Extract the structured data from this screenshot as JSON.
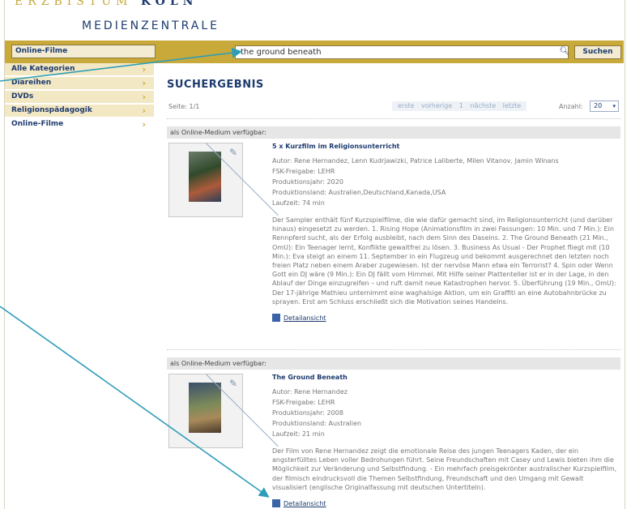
{
  "header": {
    "org_top": "ERZBISTUM",
    "org_top_bold": "KÖLN",
    "org_bottom": "MEDIENZENTRALE"
  },
  "toolbar": {
    "breadcrumb": "Online-Filme",
    "search_value": "the ground beneath",
    "search_button": "Suchen"
  },
  "sidebar": {
    "items": [
      {
        "label": "Alle Kategorien"
      },
      {
        "label": "Diareihen"
      },
      {
        "label": "DVDs"
      },
      {
        "label": "Religionspädagogik"
      },
      {
        "label": "Online-Filme"
      }
    ]
  },
  "main": {
    "heading": "SUCHERGEBNIS",
    "page_info": "Seite: 1/1",
    "pager": {
      "first": "erste",
      "prev": "vorherige",
      "page": "1",
      "next": "nächste",
      "last": "letzte"
    },
    "anzahl_label": "Anzahl:",
    "anzahl_value": "20"
  },
  "results": [
    {
      "availability": "als Online-Medium verfügbar:",
      "title": "5 x Kurzfilm im Religionsunterricht",
      "author": "Autor: Rene Hernandez, Lenn Kudrjawizki, Patrice Laliberte, Milen Vitanov, Jamin Winans",
      "fsk": "FSK-Freigabe: LEHR",
      "year": "Produktionsjahr: 2020",
      "country": "Produktionsland: Australien,Deutschland,Kanada,USA",
      "runtime": "Laufzeit: 74 min",
      "description": "Der Sampler enthält fünf Kurzspielfilme, die wie dafür gemacht sind, im Religionsunterricht (und darüber hinaus) eingesetzt zu werden. 1. Rising Hope (Animationsfilm in zwei Fassungen: 10 Min. und 7 Min.): Ein Rennpferd sucht, als der Erfolg ausbleibt, nach dem Sinn des Daseins. 2. The Ground Beneath (21 Min., OmU): Ein Teenager lernt, Konflikte gewaltfrei zu lösen. 3. Business As Usual - Der Prophet fliegt mit (10 Min.): Eva steigt an einem 11. September in ein Flugzeug und bekommt ausgerechnet den letzten noch freien Platz neben einem Araber zugewiesen. Ist der nervöse Mann etwa ein Terrorist? 4. Spin oder Wenn Gott ein DJ wäre (9 Min.): Ein DJ fällt vom Himmel. Mit Hilfe seiner Plattenteller ist er in der Lage, in den Ablauf der Dinge einzugreifen – und ruft damit neue Katastrophen hervor. 5. Überführung (19 Min., OmU): Der 17-jährige Mathieu unternimmt eine waghalsige Aktion, um ein Graffiti an eine Autobahnbrücke zu sprayen. Erst am Schluss erschließt sich die Motivation seines Handelns.",
      "detail_link": "Detailansicht"
    },
    {
      "availability": "als Online-Medium verfügbar:",
      "title": "The Ground Beneath",
      "author": "Autor: Rene Hernandez",
      "fsk": "FSK-Freigabe: LEHR",
      "year": "Produktionsjahr: 2008",
      "country": "Produktionsland: Australien",
      "runtime": "Laufzeit: 21 min",
      "description": "Der Film von Rene Hernandez zeigt die emotionale Reise des jungen Teenagers Kaden, der ein angsterfülltes Leben voller Bedrohungen führt. Seine Freundschaften mit Casey und Lewis bieten ihm die Möglichkeit zur Veränderung und Selbstfindung. - Ein mehrfach preisgekrönter australischer Kurzspielfilm, der filmisch eindrucksvoll die Themen Selbstfindung, Freundschaft und den Umgang mit Gewalt visualisiert (englische Originalfassung mit deutschen Untertiteln).",
      "detail_link": "Detailansicht"
    }
  ],
  "colors": {
    "brand_gold": "#c9a93a",
    "brand_blue": "#1d3b6f",
    "arrow": "#2e9db8"
  }
}
